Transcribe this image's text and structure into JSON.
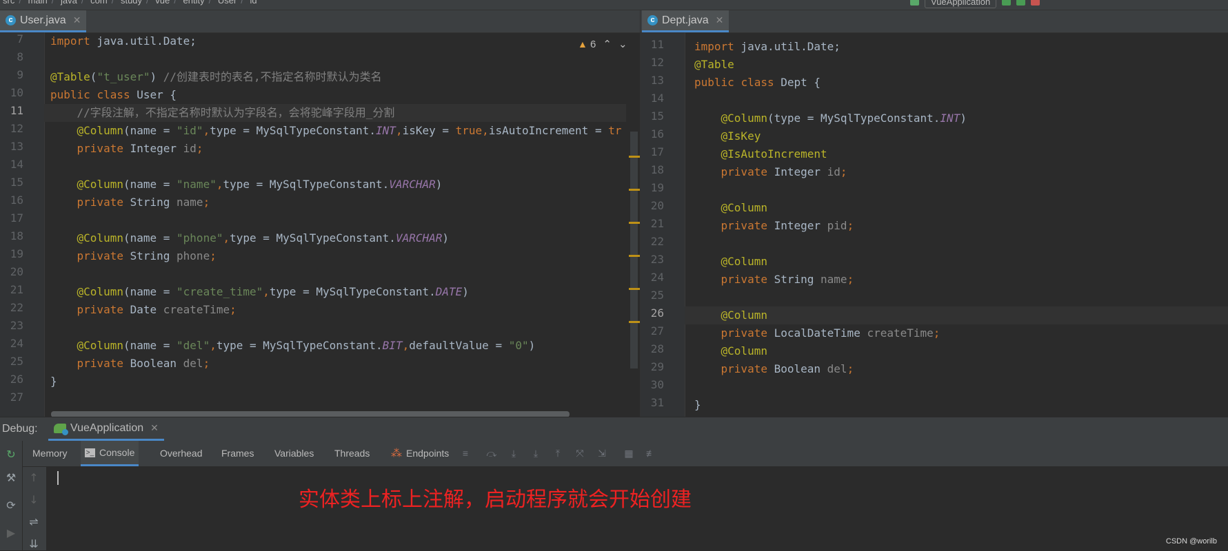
{
  "breadcrumbs": [
    "src",
    "main",
    "java",
    "com",
    "study",
    "vue",
    "entity",
    "User",
    "id"
  ],
  "run_config": "VueApplication",
  "left_editor": {
    "tab": {
      "label": "User.java",
      "icon": "class-icon"
    },
    "warnings": "6",
    "current_line": 11,
    "lines": [
      {
        "no": "7"
      },
      {
        "no": "8"
      },
      {
        "no": "9"
      },
      {
        "no": "10"
      },
      {
        "no": "11"
      },
      {
        "no": "12"
      },
      {
        "no": "13"
      },
      {
        "no": "14"
      },
      {
        "no": "15"
      },
      {
        "no": "16"
      },
      {
        "no": "17"
      },
      {
        "no": "18"
      },
      {
        "no": "19"
      },
      {
        "no": "20"
      },
      {
        "no": "21"
      },
      {
        "no": "22"
      },
      {
        "no": "23"
      },
      {
        "no": "24"
      },
      {
        "no": "25"
      },
      {
        "no": "26"
      },
      {
        "no": "27"
      }
    ],
    "code": {
      "l7_import": "import",
      "l7_rest": " java.util.Date;",
      "l9_anno": "@Table",
      "l9_open": "(",
      "l9_str": "\"t_user\"",
      "l9_close": ") ",
      "l9_comment": "//创建表时的表名,不指定名称时默认为类名",
      "l10_public": "public ",
      "l10_class": "class ",
      "l10_name": "User {",
      "l11_comment": "    //字段注解，不指定名称时默认为字段名，会将驼峰字段用_分割",
      "l12_anno": "    @Column",
      "l12_a": "(name = ",
      "l12_str": "\"id\"",
      "l12_comma": ",",
      "l12_b": "type = MySqlTypeConstant.",
      "l12_const": "INT",
      "l12_c": ",",
      "l12_d": "isKey = ",
      "l12_true": "true",
      "l12_e": ",",
      "l12_f": "isAutoIncrement = ",
      "l12_g": "tr",
      "l13_private": "    private ",
      "l13_type": "Integer ",
      "l13_var": "id",
      "l13_semi": ";",
      "l15_anno": "    @Column",
      "l15_a": "(name = ",
      "l15_str": "\"name\"",
      "l15_comma": ",",
      "l15_b": "type = MySqlTypeConstant.",
      "l15_const": "VARCHAR",
      "l15_close": ")",
      "l16_private": "    private ",
      "l16_type": "String ",
      "l16_var": "name",
      "l16_semi": ";",
      "l18_anno": "    @Column",
      "l18_a": "(name = ",
      "l18_str": "\"phone\"",
      "l18_comma": ",",
      "l18_b": "type = MySqlTypeConstant.",
      "l18_const": "VARCHAR",
      "l18_close": ")",
      "l19_private": "    private ",
      "l19_type": "String ",
      "l19_var": "phone",
      "l19_semi": ";",
      "l21_anno": "    @Column",
      "l21_a": "(name = ",
      "l21_str": "\"create_time\"",
      "l21_comma": ",",
      "l21_b": "type = MySqlTypeConstant.",
      "l21_const": "DATE",
      "l21_close": ")",
      "l22_private": "    private ",
      "l22_type": "Date ",
      "l22_var": "createTime",
      "l22_semi": ";",
      "l24_anno": "    @Column",
      "l24_a": "(name = ",
      "l24_str": "\"del\"",
      "l24_comma": ",",
      "l24_b": "type = MySqlTypeConstant.",
      "l24_const": "BIT",
      "l24_c": ",",
      "l24_d": "defaultValue = ",
      "l24_str2": "\"0\"",
      "l24_close": ")",
      "l25_private": "    private ",
      "l25_type": "Boolean ",
      "l25_var": "del",
      "l25_semi": ";",
      "l26_close": "}"
    }
  },
  "right_editor": {
    "tab": {
      "label": "Dept.java",
      "icon": "class-icon"
    },
    "current_line": 26,
    "lines": [
      {
        "no": "11"
      },
      {
        "no": "12"
      },
      {
        "no": "13"
      },
      {
        "no": "14"
      },
      {
        "no": "15"
      },
      {
        "no": "16"
      },
      {
        "no": "17"
      },
      {
        "no": "18"
      },
      {
        "no": "19"
      },
      {
        "no": "20"
      },
      {
        "no": "21"
      },
      {
        "no": "22"
      },
      {
        "no": "23"
      },
      {
        "no": "24"
      },
      {
        "no": "25"
      },
      {
        "no": "26"
      },
      {
        "no": "27"
      },
      {
        "no": "28"
      },
      {
        "no": "29"
      },
      {
        "no": "30"
      },
      {
        "no": "31"
      }
    ],
    "code": {
      "l11_import": "import",
      "l11_rest": " java.util.Date;",
      "l12_anno": "@Table",
      "l13_public": "public ",
      "l13_class": "class ",
      "l13_name": "Dept {",
      "l15_anno": "    @Column",
      "l15_a": "(type = MySqlTypeConstant.",
      "l15_const": "INT",
      "l15_close": ")",
      "l16_anno": "    @IsKey",
      "l17_anno": "    @IsAutoIncrement",
      "l18_private": "    private ",
      "l18_type": "Integer ",
      "l18_var": "id",
      "l18_semi": ";",
      "l20_anno": "    @Column",
      "l21_private": "    private ",
      "l21_type": "Integer ",
      "l21_var": "pid",
      "l21_semi": ";",
      "l23_anno": "    @Column",
      "l24_private": "    private ",
      "l24_type": "String ",
      "l24_var": "name",
      "l24_semi": ";",
      "l26_anno": "    @Column",
      "l27_private": "    private ",
      "l27_type": "LocalDateTime ",
      "l27_var": "createTime",
      "l27_semi": ";",
      "l28_anno": "    @Column",
      "l29_private": "    private ",
      "l29_type": "Boolean ",
      "l29_var": "del",
      "l29_semi": ";",
      "l31_close": "}"
    }
  },
  "debug": {
    "label": "Debug:",
    "session_tab": "VueApplication",
    "tabs": {
      "memory": "Memory",
      "console": "Console",
      "overhead": "Overhead",
      "frames": "Frames",
      "variables": "Variables",
      "threads": "Threads",
      "endpoints": "Endpoints"
    },
    "selected_tab": "Console"
  },
  "annotation": "实体类上标上注解，启动程序就会开始创建",
  "watermark": "CSDN @worilb",
  "colors": {
    "keyword": "#cc7832",
    "annotation": "#bbb529",
    "string": "#6a8759",
    "comment": "#808080",
    "constant": "#9876aa",
    "accent": "#4a88c7",
    "annotation_text": "#ee2222"
  }
}
